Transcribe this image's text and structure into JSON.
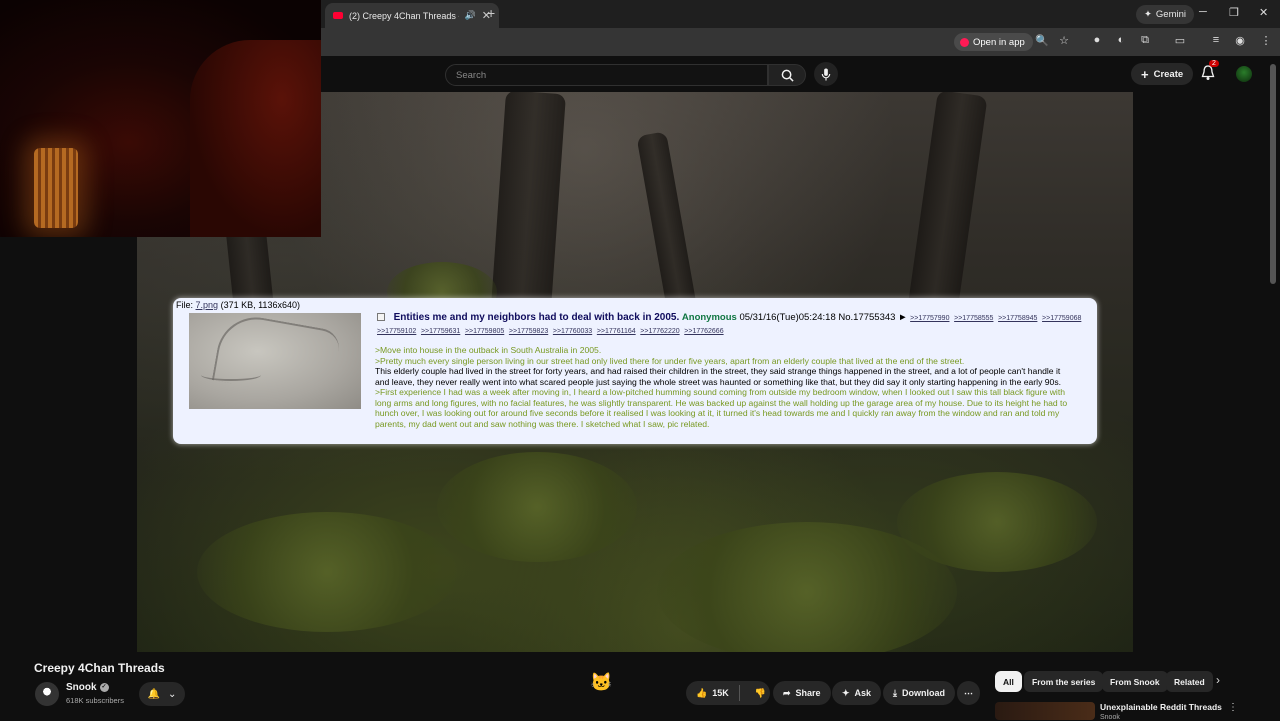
{
  "browser": {
    "tab_title": "(2) Creepy 4Chan Threads -",
    "gemini_label": "Gemini",
    "open_in_app_label": "Open in app"
  },
  "youtube": {
    "search_placeholder": "Search",
    "create_label": "Create",
    "notification_count": "2"
  },
  "post": {
    "file_label": "File:",
    "file_name": "7.png",
    "file_meta": "(371 KB, 1136x640)",
    "subject": "Entities me and my neighbors had to deal with back in 2005.",
    "name": "Anonymous",
    "datetime": "05/31/16(Tue)05:24:18",
    "post_no": "No.17755343",
    "arrow": "►",
    "replies": [
      ">>17757990",
      ">>17758555",
      ">>17758945",
      ">>17759068",
      ">>17759102",
      ">>17759631",
      ">>17759805",
      ">>17759823",
      ">>17760033",
      ">>17761164",
      ">>17762220",
      ">>17762666"
    ],
    "body": {
      "line1": ">Move into house in the outback in South Australia in 2005.",
      "line2": ">Pretty much every single person living in our street had only lived there for under five years, apart from an elderly couple that lived at the end of the street.",
      "line3": "This elderly couple had lived in the street for forty years, and had raised their children in the street, they said strange things happened in the street, and a lot of people can't handle it and leave, they never really went into what scared people just saying the whole street was haunted or something like that, but they did say it only starting happening in the early 90s.",
      "line4": ">First experience I had was a week after moving in, I heard a low-pitched humming sound coming from outside my bedroom window, when I looked out I saw this tall black figure with long arms and long figures, with no facial features, he was slightly transparent. He was backed up against the wall holding up the garage area of my house. Due to its height he had to hunch over, I was looking out for around five seconds before it realised I was looking at it, it turned it's head towards me and I quickly ran away from the window and ran and told my parents, my dad went out and saw nothing was there. I sketched what I saw, pic related."
    }
  },
  "video": {
    "title": "Creepy 4Chan Threads",
    "channel_name": "Snook",
    "subscribers": "618K subscribers",
    "likes": "15K",
    "share_label": "Share",
    "ask_label": "Ask",
    "download_label": "Download"
  },
  "chips": [
    "All",
    "From the series",
    "From Snook",
    "Related"
  ],
  "recommendation": {
    "title": "Unexplainable Reddit Threads",
    "channel": "Snook"
  },
  "colors": {
    "post_bg": "#eef2ff",
    "subject": "#0f0c5d",
    "name": "#117743",
    "greentext": "#789922",
    "link": "#34345c"
  }
}
